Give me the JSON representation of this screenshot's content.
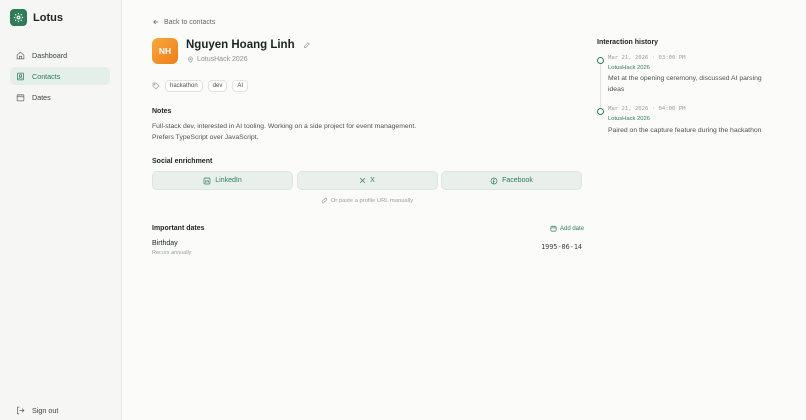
{
  "app": {
    "name": "Lotus",
    "brand_color": "#2f7d57",
    "logo_icon": "gear-icon"
  },
  "sidebar": {
    "items": [
      {
        "label": "Dashboard",
        "icon": "home-icon",
        "active": false
      },
      {
        "label": "Contacts",
        "icon": "contact-book-icon",
        "active": true
      },
      {
        "label": "Dates",
        "icon": "calendar-icon",
        "active": false
      }
    ],
    "signout_label": "Sign out"
  },
  "header": {
    "back_label": "Back to contacts"
  },
  "contact": {
    "initials": "NH",
    "name": "Nguyen Hoang Linh",
    "event": "LotusHack 2026",
    "tags": [
      "hackathon",
      "dev",
      "AI"
    ]
  },
  "notes": {
    "title": "Notes",
    "lines": [
      "Full-stack dev, interested in AI tooling. Working on a side project for event management.",
      "Prefers TypeScript over JavaScript."
    ]
  },
  "social": {
    "title": "Social enrichment",
    "buttons": [
      {
        "label": "LinkedIn",
        "icon": "linkedin-icon"
      },
      {
        "label": "X",
        "icon": "x-logo-icon"
      },
      {
        "label": "Facebook",
        "icon": "facebook-icon"
      }
    ],
    "paste_label": "Or paste a profile URL manually"
  },
  "dates": {
    "title": "Important dates",
    "add_label": "Add date",
    "items": [
      {
        "label": "Birthday",
        "sub": "Recurs annually",
        "value": "1995-06-14"
      }
    ]
  },
  "timeline": {
    "title": "Interaction history",
    "entries": [
      {
        "time": "Mar 21, 2026 · 03:00 PM",
        "event": "LotusHack 2026",
        "text": "Met at the opening ceremony, discussed AI parsing ideas"
      },
      {
        "time": "Mar 21, 2026 · 04:00 PM",
        "event": "LotusHack 2026",
        "text": "Paired on the capture feature during the hackathon"
      }
    ]
  }
}
